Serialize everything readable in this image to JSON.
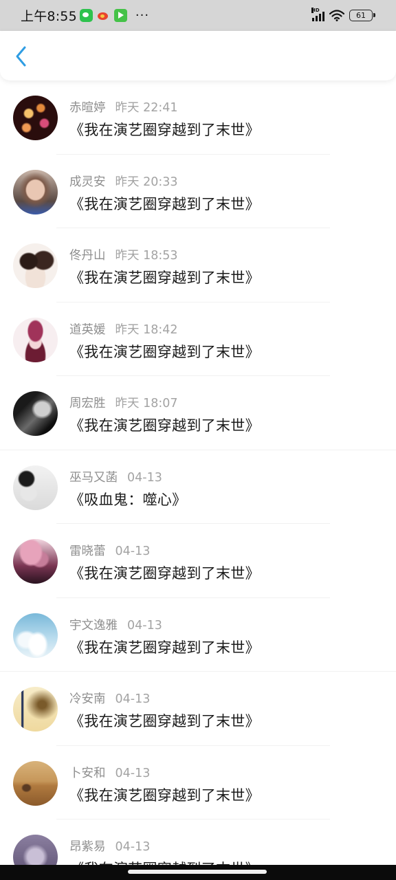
{
  "status_bar": {
    "time": "上午8:55",
    "more": "···",
    "signal_tag": "HD",
    "battery": "61",
    "icons": [
      "wechat-icon",
      "weibo-icon",
      "iqiyi-icon",
      "signal-icon",
      "wifi-icon",
      "battery-icon"
    ]
  },
  "header": {
    "back_icon": "chevron-left-icon",
    "accent_color": "#2f9de3"
  },
  "comments": [
    {
      "name": "赤暄婷",
      "time": "昨天 22:41",
      "book": "《我在演艺圈穿越到了末世》"
    },
    {
      "name": "成灵安",
      "time": "昨天 20:33",
      "book": "《我在演艺圈穿越到了末世》"
    },
    {
      "name": "佟丹山",
      "time": "昨天 18:53",
      "book": "《我在演艺圈穿越到了末世》"
    },
    {
      "name": "道英媛",
      "time": "昨天 18:42",
      "book": "《我在演艺圈穿越到了末世》"
    },
    {
      "name": "周宏胜",
      "time": "昨天 18:07",
      "book": "《我在演艺圈穿越到了末世》"
    },
    {
      "name": "巫马又菡",
      "time": "04-13",
      "book": "《吸血鬼：噬心》"
    },
    {
      "name": "雷晓蕾",
      "time": "04-13",
      "book": "《我在演艺圈穿越到了末世》"
    },
    {
      "name": "宇文逸雅",
      "time": "04-13",
      "book": "《我在演艺圈穿越到了末世》"
    },
    {
      "name": "冷安南",
      "time": "04-13",
      "book": "《我在演艺圈穿越到了末世》"
    },
    {
      "name": "卜安和",
      "time": "04-13",
      "book": "《我在演艺圈穿越到了末世》"
    },
    {
      "name": "昂紫易",
      "time": "04-13",
      "book": "《我在演艺圈穿越到了末世》"
    }
  ]
}
